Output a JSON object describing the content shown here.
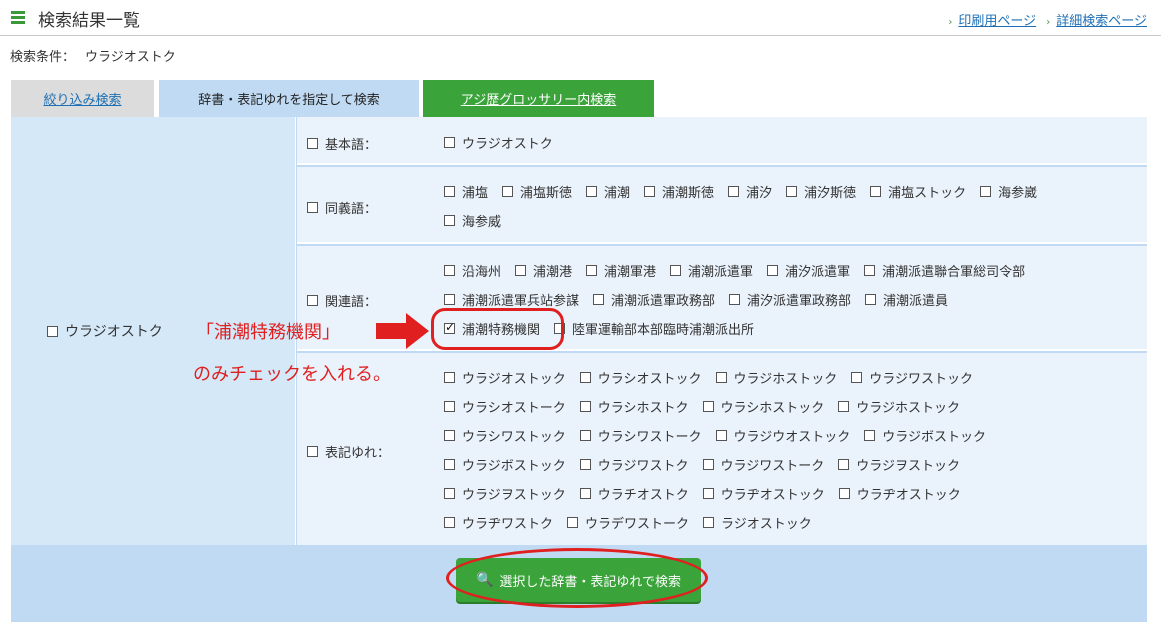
{
  "header": {
    "title": "検索結果一覧",
    "links": [
      "印刷用ページ",
      "詳細検索ページ"
    ]
  },
  "conditions": {
    "label": "検索条件：",
    "value": "ウラジオストク"
  },
  "tabs": [
    "絞り込み検索",
    "辞書・表記ゆれを指定して検索",
    "アジ歴グロッサリー内検索"
  ],
  "word": {
    "label": "ウラジオストク",
    "checked": false
  },
  "rows": {
    "basic": {
      "label": "基本語：",
      "items": [
        "ウラジオストク"
      ]
    },
    "synonym": {
      "label": "同義語：",
      "items": [
        "浦塩",
        "浦塩斯徳",
        "浦潮",
        "浦潮斯徳",
        "浦汐",
        "浦汐斯徳",
        "浦塩ストック",
        "海参崴",
        "海参威"
      ]
    },
    "related": {
      "label": "関連語：",
      "items": [
        "沿海州",
        "浦潮港",
        "浦潮軍港",
        "浦潮派遣軍",
        "浦汐派遣軍",
        "浦潮派遣聯合軍総司令部",
        "浦潮派遣軍兵站参謀",
        "浦潮派遣軍政務部",
        "浦汐派遣軍政務部",
        "浦潮派遣員",
        "浦潮特務機関",
        "陸軍運輸部本部臨時浦潮派出所"
      ],
      "checked_item": "浦潮特務機関"
    },
    "variant": {
      "label": "表記ゆれ：",
      "items": [
        "ウラジオストック",
        "ウラシオストック",
        "ウラジホストック",
        "ウラジワストック",
        "ウラシオストーク",
        "ウラシホストク",
        "ウラシホストック",
        "ウラジホストック",
        "ウラシワストック",
        "ウラシワストーク",
        "ウラジウオストック",
        "ウラジボストック",
        "ウラジボストック",
        "ウラジワストク",
        "ウラジワストーク",
        "ウラジヲストック",
        "ウラジヲストック",
        "ウラチオストク",
        "ウラヂオストック",
        "ウラヂオストック",
        "ウラヂワストク",
        "ウラデワストーク",
        "ラジオストック"
      ]
    }
  },
  "search_button": {
    "label": "選択した辞書・表記ゆれで検索",
    "color": "#3aa33a"
  },
  "annotation": {
    "line1": "「浦潮特務機関」",
    "line2": "のみチェックを入れる。",
    "color": "#e02020"
  }
}
